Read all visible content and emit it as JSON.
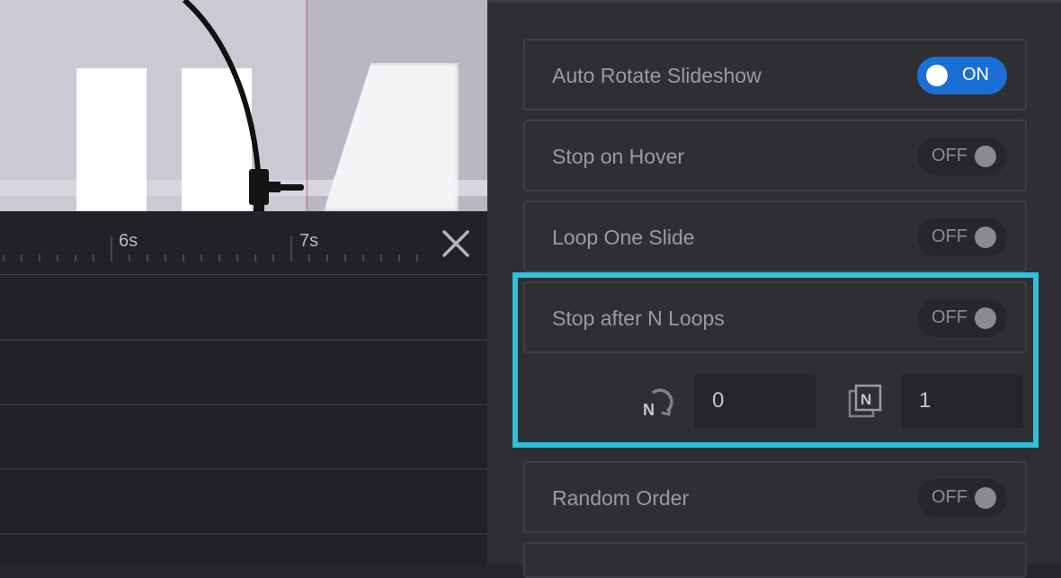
{
  "timeline": {
    "ticks": [
      "6s",
      "7s"
    ],
    "close_icon": "close-icon"
  },
  "settings": {
    "auto_rotate": {
      "label": "Auto Rotate Slideshow",
      "state": "ON"
    },
    "stop_on_hover": {
      "label": "Stop on Hover",
      "state": "OFF"
    },
    "loop_one_slide": {
      "label": "Loop One Slide",
      "state": "OFF"
    },
    "stop_after_n_loops": {
      "label": "Stop after N Loops",
      "state": "OFF"
    },
    "loops_value": "0",
    "slide_value": "1",
    "random_order": {
      "label": "Random Order",
      "state": "OFF"
    }
  },
  "icons": {
    "loop_count": "loop-count-icon",
    "slide_number": "slide-number-icon",
    "loop_glyph": "N",
    "slide_glyph": "N"
  },
  "colors": {
    "accent": "#1b6ed6",
    "highlight": "#2dc3dd",
    "playhead": "#e1656b"
  }
}
